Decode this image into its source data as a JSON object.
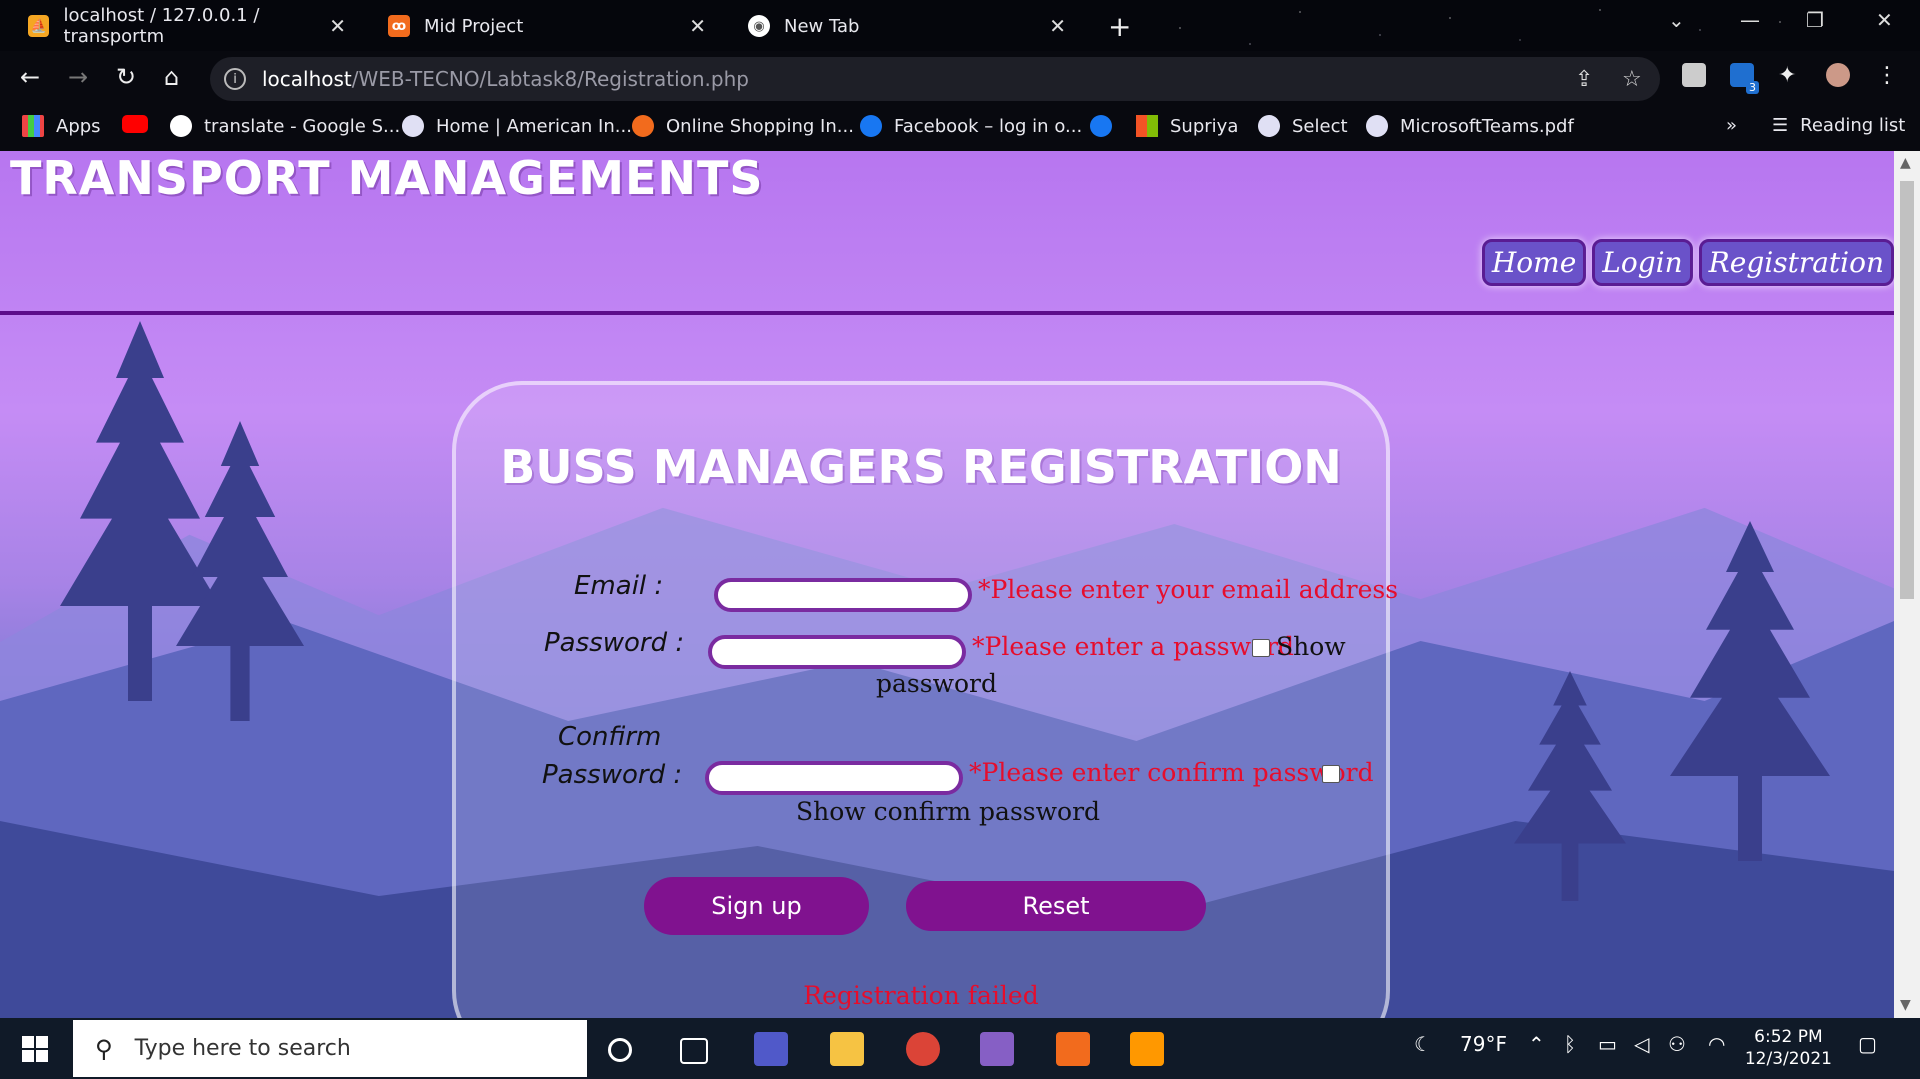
{
  "browser": {
    "tabs": [
      {
        "title": "localhost / 127.0.0.1 / transportm"
      },
      {
        "title": "Mid Project"
      },
      {
        "title": "New Tab"
      }
    ],
    "url_host": "localhost",
    "url_path": "/WEB-TECNO/Labtask8/Registration.php",
    "extension_badge": "3",
    "bookmarks": [
      "Apps",
      "translate - Google S...",
      "Home | American In...",
      "Online Shopping In...",
      "Facebook – log in o...",
      "Supriya",
      "Select",
      "MicrosoftTeams.pdf"
    ],
    "reading_list": "Reading list",
    "overflow": "»"
  },
  "site": {
    "title": "TRANSPORT MANAGEMENTS",
    "nav": [
      "Home",
      "Login",
      "Registration"
    ]
  },
  "form": {
    "title": "BUSS MANAGERS REGISTRATION",
    "email_label": "Email :",
    "email_error": "*Please enter your email address",
    "password_label": "Password :",
    "password_error": "*Please enter a password",
    "show_password_1": "Show",
    "show_password_2": "password",
    "confirm_label_1": "Confirm",
    "confirm_label_2": "Password :",
    "confirm_error": "*Please enter confirm password",
    "show_confirm": "Show confirm password",
    "signup": "Sign up",
    "reset": "Reset",
    "status": "Registration failed"
  },
  "taskbar": {
    "search_placeholder": "Type here to search",
    "weather": "79°F",
    "time": "6:52 PM",
    "date": "12/3/2021"
  },
  "colors": {
    "accent": "#80128f",
    "error": "#e60d2c",
    "header_border": "#5c0d8a"
  }
}
